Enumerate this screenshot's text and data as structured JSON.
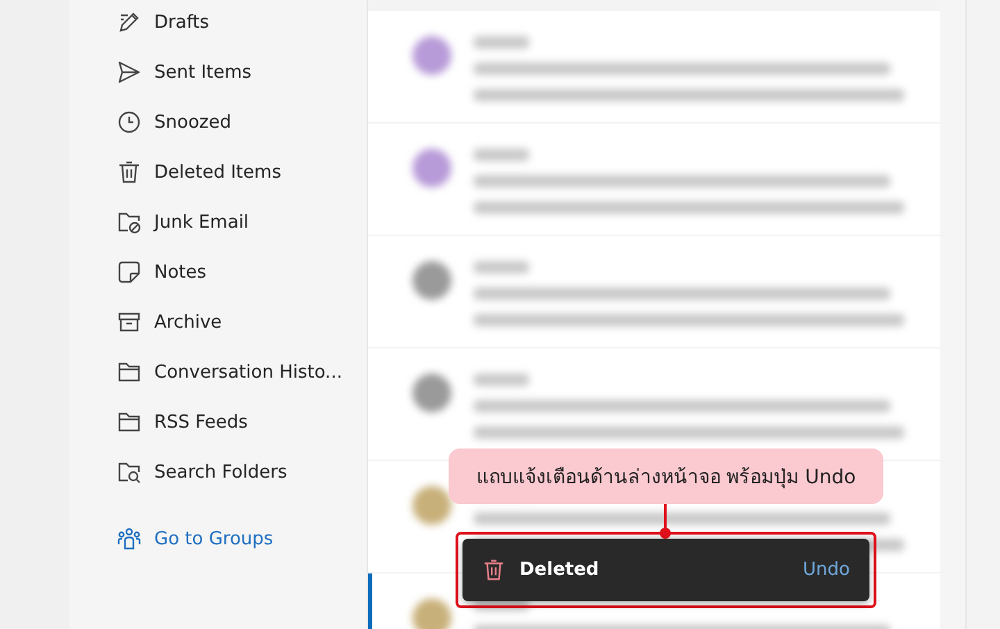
{
  "sidebar": {
    "items": [
      {
        "label": "Drafts"
      },
      {
        "label": "Sent Items"
      },
      {
        "label": "Snoozed"
      },
      {
        "label": "Deleted Items"
      },
      {
        "label": "Junk Email"
      },
      {
        "label": "Notes"
      },
      {
        "label": "Archive"
      },
      {
        "label": "Conversation Histo..."
      },
      {
        "label": "RSS Feeds"
      },
      {
        "label": "Search Folders"
      }
    ],
    "groups_link": "Go to Groups"
  },
  "email_list": {
    "rows": [
      {
        "color": "#b79ad8",
        "selected": false
      },
      {
        "color": "#b79ad8",
        "selected": false
      },
      {
        "color": "#9a9a9a",
        "selected": false
      },
      {
        "color": "#9a9a9a",
        "selected": false
      },
      {
        "color": "#c8b07a",
        "selected": false
      },
      {
        "color": "#c8b07a",
        "selected": true
      }
    ]
  },
  "annotation": {
    "text": "แถบแจ้งเตือนด้านล่างหน้าจอ พร้อมปุ่ม Undo"
  },
  "toast": {
    "label": "Deleted",
    "action": "Undo"
  }
}
